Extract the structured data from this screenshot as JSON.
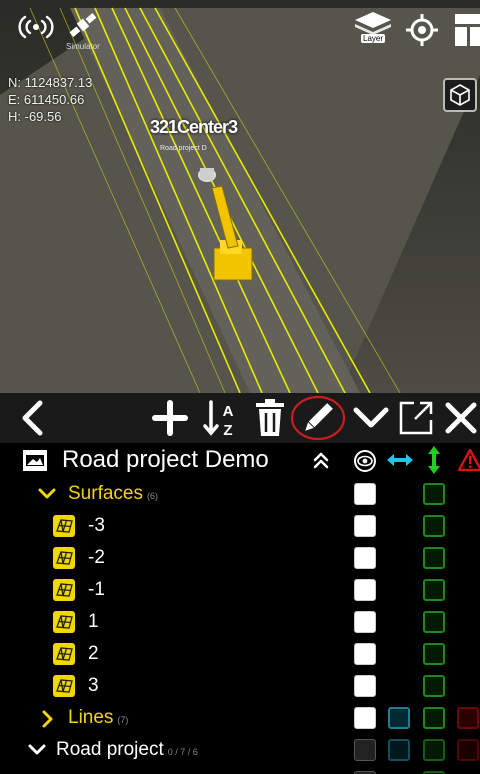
{
  "map": {
    "simulator_label": "Simulator",
    "layer_label": "Layer",
    "coords": {
      "n": "N: 1124837.13",
      "e": "E: 611450.66",
      "h": "H: -69.56"
    },
    "center_label": "Center",
    "station_left": "321",
    "station_right": "3",
    "road_label": "Road project D",
    "colors": {
      "grass": "#4a4a42",
      "road": "#5a5a52",
      "lines": "#e8e800",
      "machine": "#f2c400"
    }
  },
  "toolbar": {
    "icons": [
      "back-icon",
      "add-icon",
      "sort-az-icon",
      "delete-icon",
      "edit-icon",
      "expand-icon",
      "open-external-icon",
      "close-icon"
    ],
    "highlight_color": "#c81e1e"
  },
  "tree": {
    "header": {
      "title": "Road project Demo",
      "columns": [
        "visibility-icon",
        "horizontal-arrows-icon",
        "vertical-arrows-icon",
        "warning-icon"
      ]
    },
    "surfaces": {
      "label": "Surfaces",
      "count": "(6)"
    },
    "surface_items": [
      "-3",
      "-2",
      "-1",
      "1",
      "2",
      "3"
    ],
    "lines": {
      "label": "Lines",
      "count": "(7)"
    },
    "road_project": {
      "label": "Road project",
      "count": "0 / 7 / 6"
    },
    "colors": {
      "folder_label": "#f2d600",
      "check_green": "#1d8a1d",
      "check_cyan": "#1e7f8f",
      "warning": "#e01010"
    }
  }
}
